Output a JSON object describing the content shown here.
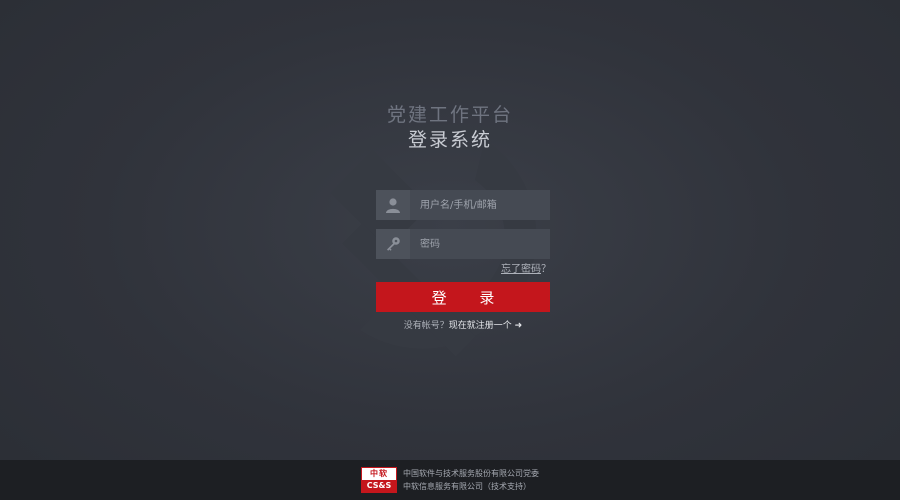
{
  "header": {
    "subtitle": "党建工作平台",
    "title": "登录系统"
  },
  "form": {
    "username": {
      "placeholder": "用户名/手机/邮箱",
      "value": "",
      "icon": "user-icon"
    },
    "password": {
      "placeholder": "密码",
      "value": "",
      "icon": "key-icon"
    },
    "forgot_link": "忘了密码",
    "forgot_suffix": "？",
    "login_button": "登 录",
    "register_prefix": "没有帐号？",
    "register_link": "现在就注册一个 ➜"
  },
  "footer": {
    "logo_top": "中软",
    "logo_bottom": "CS&S",
    "line1": "中国软件与技术服务股份有限公司党委",
    "line2": "中软信息服务有限公司（技术支持）"
  },
  "colors": {
    "accent": "#c4161c",
    "background": "#30333b",
    "footer": "#1d1f23"
  }
}
